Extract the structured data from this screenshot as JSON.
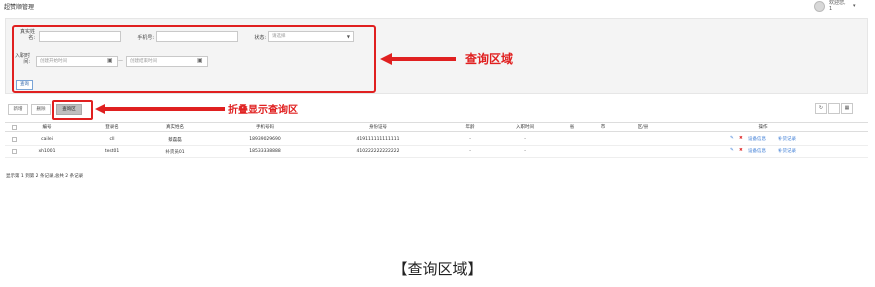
{
  "app": {
    "title": "超赞顺管理",
    "user_greeting": "欢迎您,",
    "user_name": "1",
    "user_caret": "▾"
  },
  "search": {
    "real_name_label": "真实姓名:",
    "real_name_value": "",
    "phone_label": "手机号:",
    "phone_value": "",
    "status_label": "状态:",
    "status_placeholder": "请选择",
    "entry_time_label": "入职时间:",
    "start_placeholder": "创建开始时间",
    "end_placeholder": "创建结束时间",
    "dash": "—",
    "query_button": "查询"
  },
  "annotations": {
    "query_area": "查询区域",
    "toggle_hint": "折叠显示查询区",
    "caption": "【查询区域】",
    "color": "#e02020"
  },
  "toolbar": {
    "add": "新增",
    "delete": "删除",
    "query_area": "查询区"
  },
  "table": {
    "columns": [
      "编号",
      "登录名",
      "真实姓名",
      "手机号码",
      "身份证号",
      "年龄",
      "入职时间",
      "省",
      "市",
      "区/县",
      "操作"
    ],
    "rows": [
      {
        "id": "cailei",
        "login": "cll",
        "name": "蔡磊磊",
        "phone": "18939029690",
        "idcard": "419111111111111",
        "age": "-",
        "entry": "-"
      },
      {
        "id": "xh1001",
        "login": "test01",
        "name": "补货员01",
        "phone": "18533338888",
        "idcard": "410222222222222",
        "age": "-",
        "entry": "-"
      }
    ],
    "operations": {
      "set_info": "设备信息",
      "restock": "补货记录"
    },
    "pager": "显示第 1 到第 2 条记录,总共 2 条记录"
  }
}
